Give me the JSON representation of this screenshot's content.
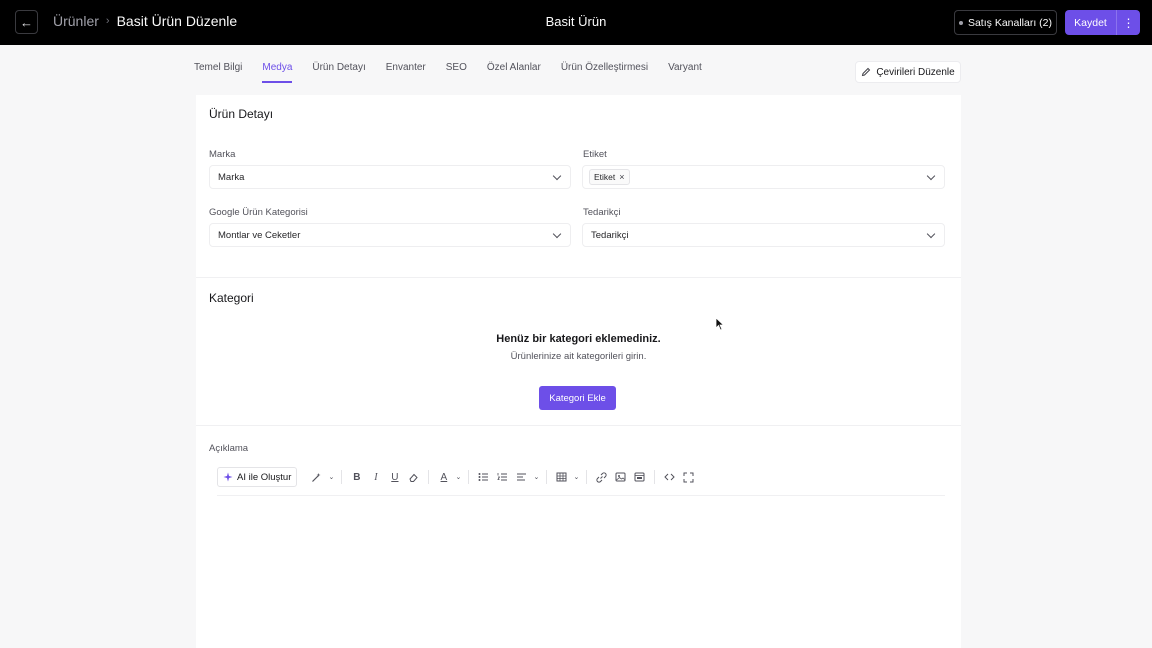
{
  "topbar": {
    "back_icon": "arrow-left-icon",
    "breadcrumb_parent": "Ürünler",
    "breadcrumb_separator": "›",
    "breadcrumb_current": "Basit Ürün Düzenle",
    "center_title": "Basit Ürün",
    "channels_label": "Satış Kanalları (2)",
    "save_label": "Kaydet",
    "more_label": "⋮",
    "accent_color": "#6d4fe8"
  },
  "tabs": [
    {
      "label": "Temel Bilgi",
      "active": false
    },
    {
      "label": "Medya",
      "active": true
    },
    {
      "label": "Ürün Detayı",
      "active": false
    },
    {
      "label": "Envanter",
      "active": false
    },
    {
      "label": "SEO",
      "active": false
    },
    {
      "label": "Özel Alanlar",
      "active": false
    },
    {
      "label": "Ürün Özelleştirmesi",
      "active": false
    },
    {
      "label": "Varyant",
      "active": false
    }
  ],
  "translate_label": "Çevirileri Düzenle",
  "product_detail": {
    "title": "Ürün Detayı",
    "brand_label": "Marka",
    "brand_value": "Marka",
    "tag_label": "Etiket",
    "tag_chip": "Etiket",
    "tag_remove": "×",
    "google_label": "Google Ürün Kategorisi",
    "google_value": "Montlar ve Ceketler",
    "supplier_label": "Tedarikçi",
    "supplier_value": "Tedarikçi"
  },
  "category": {
    "title": "Kategori",
    "empty_title": "Henüz bir kategori eklemediniz.",
    "empty_subtitle": "Ürünlerinize ait kategorileri girin.",
    "add_button": "Kategori Ekle"
  },
  "description": {
    "label": "Açıklama",
    "ai_button": "AI ile Oluştur",
    "content": ""
  }
}
